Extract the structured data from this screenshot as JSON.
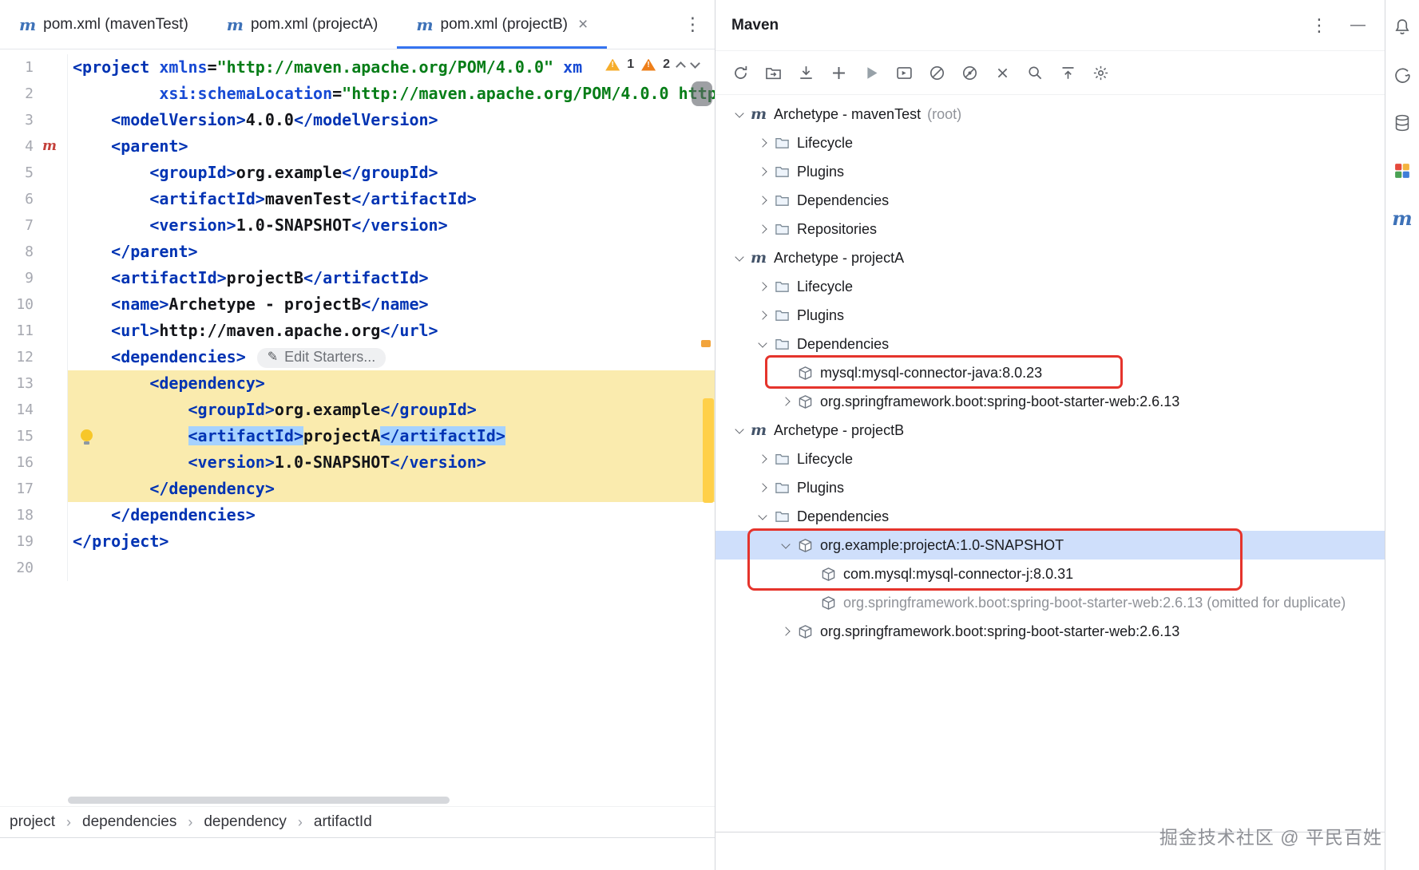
{
  "window": {
    "watermark": "掘金技术社区 @ 平民百姓"
  },
  "colors": {
    "accent": "#3574F0",
    "annotation_red": "#E5342C",
    "code_highlight_yellow": "#FAEBAE",
    "token_selection_blue": "#A6D2FF",
    "tree_selection_blue": "#CFDFFB",
    "xml_tag": "#0033B3",
    "xml_attr": "#174AD4",
    "xml_string": "#067D17",
    "maven_logo_blue": "#3E72B8"
  },
  "tabs": {
    "items": [
      {
        "label": "pom.xml (mavenTest)",
        "icon": "maven-logo",
        "active": false,
        "closable": false
      },
      {
        "label": "pom.xml (projectA)",
        "icon": "maven-logo",
        "active": false,
        "closable": false
      },
      {
        "label": "pom.xml (projectB)",
        "icon": "maven-logo",
        "active": true,
        "closable": true
      }
    ],
    "close_glyph": "×",
    "more_icon": "⋮"
  },
  "editor": {
    "inspections": {
      "warning_count": "1",
      "weak_warning_count": "2"
    },
    "hint_chip": "Edit Starters...",
    "lines": [
      {
        "n": 1,
        "widget": true,
        "seg": [
          [
            "tag",
            "<project"
          ],
          [
            "text",
            " "
          ],
          [
            "attr",
            "xmlns"
          ],
          [
            "text",
            "="
          ],
          [
            "string",
            "\"http://maven.apache.org/POM/4.0.0\""
          ],
          [
            "text",
            " "
          ],
          [
            "attr",
            "xm"
          ]
        ]
      },
      {
        "n": 2,
        "seg": [
          [
            "text",
            "         "
          ],
          [
            "attr",
            "xsi:schemaLocation"
          ],
          [
            "text",
            "="
          ],
          [
            "string",
            "\"http://maven.apache.org/POM/4.0.0 http"
          ]
        ]
      },
      {
        "n": 3,
        "seg": [
          [
            "text",
            "    "
          ],
          [
            "tag",
            "<modelVersion>"
          ],
          [
            "text",
            "4.0.0"
          ],
          [
            "tag",
            "</modelVersion>"
          ]
        ]
      },
      {
        "n": 4,
        "gutter": "maven-module",
        "seg": [
          [
            "text",
            "    "
          ],
          [
            "tag",
            "<parent>"
          ]
        ]
      },
      {
        "n": 5,
        "seg": [
          [
            "text",
            "        "
          ],
          [
            "tag",
            "<groupId>"
          ],
          [
            "text",
            "org.example"
          ],
          [
            "tag",
            "</groupId>"
          ]
        ]
      },
      {
        "n": 6,
        "seg": [
          [
            "text",
            "        "
          ],
          [
            "tag",
            "<artifactId>"
          ],
          [
            "text",
            "mavenTest"
          ],
          [
            "tag",
            "</artifactId>"
          ]
        ]
      },
      {
        "n": 7,
        "seg": [
          [
            "text",
            "        "
          ],
          [
            "tag",
            "<version>"
          ],
          [
            "text",
            "1.0-SNAPSHOT"
          ],
          [
            "tag",
            "</version>"
          ]
        ]
      },
      {
        "n": 8,
        "seg": [
          [
            "text",
            "    "
          ],
          [
            "tag",
            "</parent>"
          ]
        ]
      },
      {
        "n": 9,
        "seg": [
          [
            "text",
            "    "
          ],
          [
            "tag",
            "<artifactId>"
          ],
          [
            "text",
            "projectB"
          ],
          [
            "tag",
            "</artifactId>"
          ]
        ]
      },
      {
        "n": 10,
        "seg": [
          [
            "text",
            "    "
          ],
          [
            "tag",
            "<name>"
          ],
          [
            "text",
            "Archetype - projectB"
          ],
          [
            "tag",
            "</name>"
          ]
        ]
      },
      {
        "n": 11,
        "seg": [
          [
            "text",
            "    "
          ],
          [
            "tag",
            "<url>"
          ],
          [
            "text",
            "http://maven.apache.org"
          ],
          [
            "tag",
            "</url>"
          ]
        ]
      },
      {
        "n": 12,
        "hint": true,
        "seg": [
          [
            "text",
            "    "
          ],
          [
            "tag",
            "<dependencies>"
          ]
        ]
      },
      {
        "n": 13,
        "block": true,
        "seg": [
          [
            "text",
            "        "
          ],
          [
            "tag",
            "<dependency>"
          ]
        ]
      },
      {
        "n": 14,
        "block": true,
        "seg": [
          [
            "text",
            "            "
          ],
          [
            "tag",
            "<groupId>"
          ],
          [
            "text",
            "org.example"
          ],
          [
            "tag",
            "</groupId>"
          ]
        ]
      },
      {
        "n": 15,
        "block": true,
        "bulb": true,
        "seg": [
          [
            "text",
            "            "
          ],
          [
            "tag",
            "<artifactId>",
            "hl"
          ],
          [
            "text",
            "projectA"
          ],
          [
            "tag",
            "</artifactId>",
            "hl"
          ]
        ]
      },
      {
        "n": 16,
        "block": true,
        "seg": [
          [
            "text",
            "            "
          ],
          [
            "tag",
            "<version>"
          ],
          [
            "text",
            "1.0-SNAPSHOT"
          ],
          [
            "tag",
            "</version>"
          ]
        ]
      },
      {
        "n": 17,
        "block": true,
        "seg": [
          [
            "text",
            "        "
          ],
          [
            "tag",
            "</dependency>"
          ]
        ]
      },
      {
        "n": 18,
        "seg": [
          [
            "text",
            "    "
          ],
          [
            "tag",
            "</dependencies>"
          ]
        ]
      },
      {
        "n": 19,
        "seg": [
          [
            "tag",
            "</project>"
          ]
        ]
      },
      {
        "n": 20,
        "seg": []
      }
    ]
  },
  "breadcrumbs": {
    "items": [
      "project",
      "dependencies",
      "dependency",
      "artifactId"
    ],
    "separator": "›"
  },
  "maven_panel": {
    "title": "Maven",
    "more_icon": "⋮",
    "minimize_icon": "—",
    "toolbar_icons": [
      "reload-all-maven-projects",
      "generate-sources",
      "download-sources",
      "add-maven-project",
      "run-maven-build",
      "execute-maven-goal",
      "skip-tests",
      "toggle-offline-mode",
      "close",
      "show-dependency-analyzer",
      "collapse-all",
      "settings"
    ],
    "tree": [
      {
        "label": "Archetype - mavenTest",
        "suffix": "(root)",
        "icon": "maven-project",
        "chevron": "expanded",
        "level": 0
      },
      {
        "label": "Lifecycle",
        "icon": "folder",
        "chevron": "collapsed",
        "level": 1
      },
      {
        "label": "Plugins",
        "icon": "folder",
        "chevron": "collapsed",
        "level": 1
      },
      {
        "label": "Dependencies",
        "icon": "folder",
        "chevron": "collapsed",
        "level": 1
      },
      {
        "label": "Repositories",
        "icon": "folder",
        "chevron": "collapsed",
        "level": 1
      },
      {
        "label": "Archetype - projectA",
        "icon": "maven-project",
        "chevron": "expanded",
        "level": 0
      },
      {
        "label": "Lifecycle",
        "icon": "folder",
        "chevron": "collapsed",
        "level": 1
      },
      {
        "label": "Plugins",
        "icon": "folder",
        "chevron": "collapsed",
        "level": 1
      },
      {
        "label": "Dependencies",
        "icon": "folder",
        "chevron": "expanded",
        "level": 1
      },
      {
        "label": "mysql:mysql-connector-java:8.0.23",
        "icon": "jar",
        "level": 2
      },
      {
        "label": "org.springframework.boot:spring-boot-starter-web:2.6.13",
        "icon": "jar",
        "chevron": "collapsed",
        "level": 2
      },
      {
        "label": "Archetype - projectB",
        "icon": "maven-project",
        "chevron": "expanded",
        "level": 0
      },
      {
        "label": "Lifecycle",
        "icon": "folder",
        "chevron": "collapsed",
        "level": 1
      },
      {
        "label": "Plugins",
        "icon": "folder",
        "chevron": "collapsed",
        "level": 1
      },
      {
        "label": "Dependencies",
        "icon": "folder",
        "chevron": "expanded",
        "level": 1
      },
      {
        "label": "org.example:projectA:1.0-SNAPSHOT",
        "icon": "jar",
        "chevron": "expanded",
        "level": 2,
        "selected": true
      },
      {
        "label": "com.mysql:mysql-connector-j:8.0.31",
        "icon": "jar",
        "level": 3
      },
      {
        "label": "org.springframework.boot:spring-boot-starter-web:2.6.13 (omitted for duplicate)",
        "icon": "jar",
        "level": 3,
        "muted": true
      },
      {
        "label": "org.springframework.boot:spring-boot-starter-web:2.6.13",
        "icon": "jar",
        "chevron": "collapsed",
        "level": 2
      }
    ]
  },
  "right_strip": {
    "icons": [
      "notifications",
      "gradle",
      "database",
      "plugins",
      "maven"
    ]
  }
}
